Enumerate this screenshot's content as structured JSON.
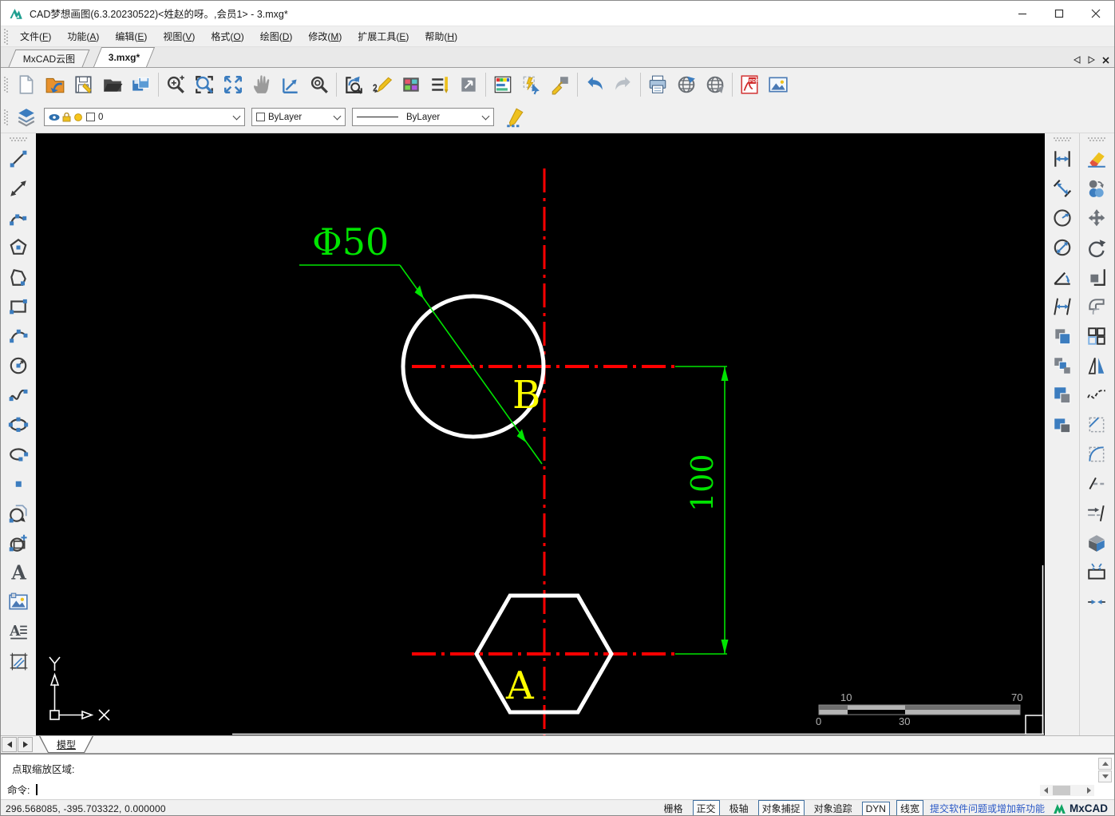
{
  "window": {
    "title": "CAD梦想画图(6.3.20230522)<姓赵的呀。,会员1> - 3.mxg*"
  },
  "menu": {
    "items": [
      {
        "label": "文件",
        "key": "F"
      },
      {
        "label": "功能",
        "key": "A"
      },
      {
        "label": "编辑",
        "key": "E"
      },
      {
        "label": "视图",
        "key": "V"
      },
      {
        "label": "格式",
        "key": "O"
      },
      {
        "label": "绘图",
        "key": "D"
      },
      {
        "label": "修改",
        "key": "M"
      },
      {
        "label": "扩展工具",
        "key": "E"
      },
      {
        "label": "帮助",
        "key": "H"
      }
    ]
  },
  "tabbar": {
    "tabs": [
      {
        "label": "MxCAD云图",
        "active": false
      },
      {
        "label": "3.mxg*",
        "active": true
      }
    ]
  },
  "toolbar": {
    "groups": [
      [
        "new-file",
        "open-web-drawing",
        "save",
        "open-file",
        "save-as"
      ],
      [
        "zoom-dynamic",
        "zoom-window",
        "zoom-extents",
        "pan",
        "zoom-scale",
        "zoom-center"
      ],
      [
        "zoom-previous",
        "quick-draw",
        "color-palette",
        "linetype-manager",
        "lineweight"
      ],
      [
        "layer-manager",
        "quick-select",
        "match-properties"
      ],
      [
        "undo",
        "redo"
      ],
      [
        "print",
        "web-publish",
        "web-open"
      ],
      [
        "export-pdf",
        "insert-image"
      ]
    ]
  },
  "properties_bar": {
    "layer": {
      "value": "0"
    },
    "color": {
      "value": "ByLayer"
    },
    "linetype": {
      "value": "ByLayer"
    }
  },
  "left_toolbar": [
    "line",
    "construction-line",
    "polyline",
    "polygon",
    "closed-polyline",
    "rectangle",
    "arc",
    "circle",
    "spline",
    "ellipse",
    "ellipse-arc",
    "point",
    "insert-block",
    "create-block",
    "single-text",
    "raster-image",
    "multiline-text",
    "hatch"
  ],
  "right_toolbar": {
    "dimension_column": [
      "dim-linear",
      "dim-aligned",
      "dim-radius",
      "dim-diameter",
      "dim-angular",
      "dim-continue",
      "copy-clip",
      "copy-base-point",
      "paste-clip",
      "paste-block"
    ],
    "modify_column": [
      "erase",
      "copy-object",
      "move",
      "rotate",
      "stretch",
      "offset",
      "array",
      "mirror",
      "edit-polyline",
      "chamfer",
      "fillet",
      "trim",
      "extend",
      "explode",
      "break",
      "join"
    ]
  },
  "drawing": {
    "diameter_label": "Φ50",
    "letter_b": "B",
    "letter_a": "A",
    "dim_value": "100",
    "axis_x": "X",
    "axis_y": "Y",
    "ruler": {
      "top_left": "10",
      "top_right": "70",
      "bottom_left": "0",
      "bottom_mid": "30"
    },
    "colors": {
      "centerline": "#ff0000",
      "dimension": "#00e400",
      "shape": "#ffffff",
      "letters": "#ffff00",
      "background": "#000000"
    }
  },
  "model_bar": {
    "tab": "模型"
  },
  "command": {
    "history_line": "点取缩放区域:",
    "prompt": "命令:"
  },
  "status_bar": {
    "coordinates": "296.568085,  -395.703322,  0.000000",
    "toggles": [
      {
        "label": "栅格",
        "boxed": false
      },
      {
        "label": "正交",
        "boxed": true
      },
      {
        "label": "极轴",
        "boxed": false
      },
      {
        "label": "对象捕捉",
        "boxed": true
      },
      {
        "label": "对象追踪",
        "boxed": false
      },
      {
        "label": "DYN",
        "boxed": true
      },
      {
        "label": "线宽",
        "boxed": true
      }
    ],
    "feedback_link": "提交软件问题或增加新功能",
    "brand": "MxCAD"
  }
}
